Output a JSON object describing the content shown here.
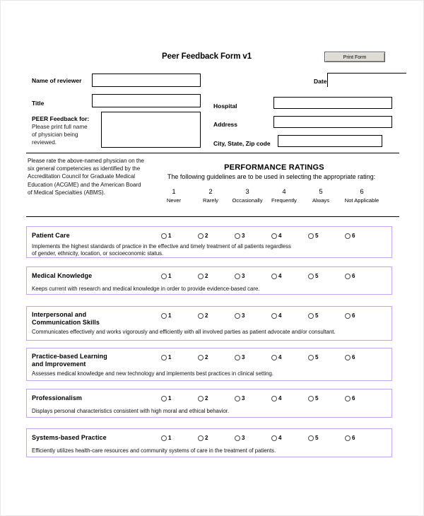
{
  "header": {
    "title": "Peer Feedback Form v1",
    "print_button": "Print Form"
  },
  "fields": {
    "name_of_reviewer": {
      "label": "Name of reviewer",
      "value": "",
      "placeholder": ""
    },
    "date": {
      "label": "Date",
      "value": "",
      "placeholder": ""
    },
    "title": {
      "label": "Title",
      "value": "",
      "placeholder": ""
    },
    "hospital": {
      "label": "Hospital",
      "value": "",
      "placeholder": ""
    },
    "peer_feedback_for": {
      "label": "PEER Feedback for:",
      "sub_line1": "Please print full name",
      "sub_line2": "of physician being",
      "sub_line3": "reviewed.",
      "value": "",
      "placeholder": ""
    },
    "address": {
      "label": "Address",
      "value": "",
      "placeholder": ""
    },
    "city_state_zip": {
      "label": "City, State, Zip code",
      "value": "",
      "placeholder": ""
    }
  },
  "ratings_section": {
    "intro_paragraph": "Please rate the above-named physician on the six general competencies as identified by the Accreditation Council for Graduate Medical Education (ACGME) and the American Board of Medical Specialties (ABMS).",
    "heading": "PERFORMANCE RATINGS",
    "subheading": "The following guidelines are to be used in selecting the appropriate rating:",
    "scale": [
      {
        "number": "1",
        "word": "Never"
      },
      {
        "number": "2",
        "word": "Rarely"
      },
      {
        "number": "3",
        "word": "Occasionally"
      },
      {
        "number": "4",
        "word": "Frequently"
      },
      {
        "number": "5",
        "word": "Always"
      },
      {
        "number": "6",
        "word": "Not Applicable"
      }
    ]
  },
  "competencies": [
    {
      "title": "Patient Care",
      "title_line2": "",
      "description_line1": "Implements the highest standards of practice in the effective and timely treatment of all patients regardless",
      "description_line2": "of gender, ethnicity, location, or socioeconomic status.",
      "options": [
        "1",
        "2",
        "3",
        "4",
        "5",
        "6"
      ],
      "selected": null
    },
    {
      "title": "Medical Knowledge",
      "title_line2": "",
      "description_line1": "Keeps current with research and medical knowledge in order to provide evidence-based care.",
      "description_line2": "",
      "options": [
        "1",
        "2",
        "3",
        "4",
        "5",
        "6"
      ],
      "selected": null
    },
    {
      "title": "Interpersonal and",
      "title_line2": "Communication Skills",
      "description_line1": "Communicates effectively and works vigorously and efficiently with all involved parties as patient advocate and/or consultant.",
      "description_line2": "",
      "options": [
        "1",
        "2",
        "3",
        "4",
        "5",
        "6"
      ],
      "selected": null
    },
    {
      "title": "Practice-based Learning",
      "title_line2": "and Improvement",
      "description_line1": "Assesses medical knowledge and new technology and implements best practices in clinical setting.",
      "description_line2": "",
      "options": [
        "1",
        "2",
        "3",
        "4",
        "5",
        "6"
      ],
      "selected": null
    },
    {
      "title": "Professionalism",
      "title_line2": "",
      "description_line1": "Displays personal characteristics consistent with high moral and ethical behavior.",
      "description_line2": "",
      "options": [
        "1",
        "2",
        "3",
        "4",
        "5",
        "6"
      ],
      "selected": null
    },
    {
      "title": "Systems-based Practice",
      "title_line2": "",
      "description_line1": "Efficiently utilizes health-care resources and community systems of care in the treatment of patients.",
      "description_line2": "",
      "options": [
        "1",
        "2",
        "3",
        "4",
        "5",
        "6"
      ],
      "selected": null
    }
  ],
  "colors": {
    "competency_border": "#c9a4f0",
    "rule": "#000000",
    "button_face": "#dedcd4",
    "page_border": "#e8e8e8"
  }
}
